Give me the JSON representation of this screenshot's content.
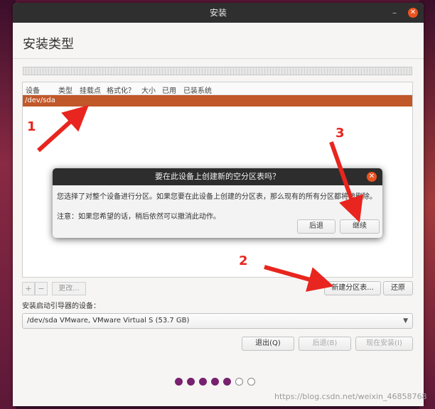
{
  "window": {
    "title": "安装"
  },
  "page": {
    "heading": "安装类型"
  },
  "table": {
    "columns": [
      "设备",
      "类型",
      "挂载点",
      "格式化？",
      "大小",
      "已用",
      "已装系统"
    ],
    "rows": [
      {
        "device": "/dev/sda"
      }
    ]
  },
  "toolbar": {
    "add": "+",
    "remove": "−",
    "change": "更改..."
  },
  "buttons": {
    "new_table": "新建分区表...",
    "revert": "还原",
    "quit": "退出(Q)",
    "back": "后退(B)",
    "install_now": "现在安装(I)"
  },
  "boot": {
    "label": "安装启动引导器的设备：",
    "selected": "/dev/sda VMware, VMware Virtual S (53.7 GB)"
  },
  "progress": {
    "total": 7,
    "done": 5
  },
  "dialog": {
    "title": "要在此设备上创建新的空分区表吗？",
    "message1": "您选择了对整个设备进行分区。如果您要在此设备上创建的分区表，那么现有的所有分区都将被删除。",
    "message2": "注意：如果您希望的话，稍后依然可以撤消此动作。",
    "back": "后退",
    "continue": "继续"
  },
  "annotations": [
    "1",
    "2",
    "3"
  ],
  "watermark": "https://blog.csdn.net/weixin_46858768",
  "colors": {
    "accent": "#e95420",
    "selection": "#c0582a",
    "arrow": "#e8251e",
    "progress": "#77216f"
  }
}
